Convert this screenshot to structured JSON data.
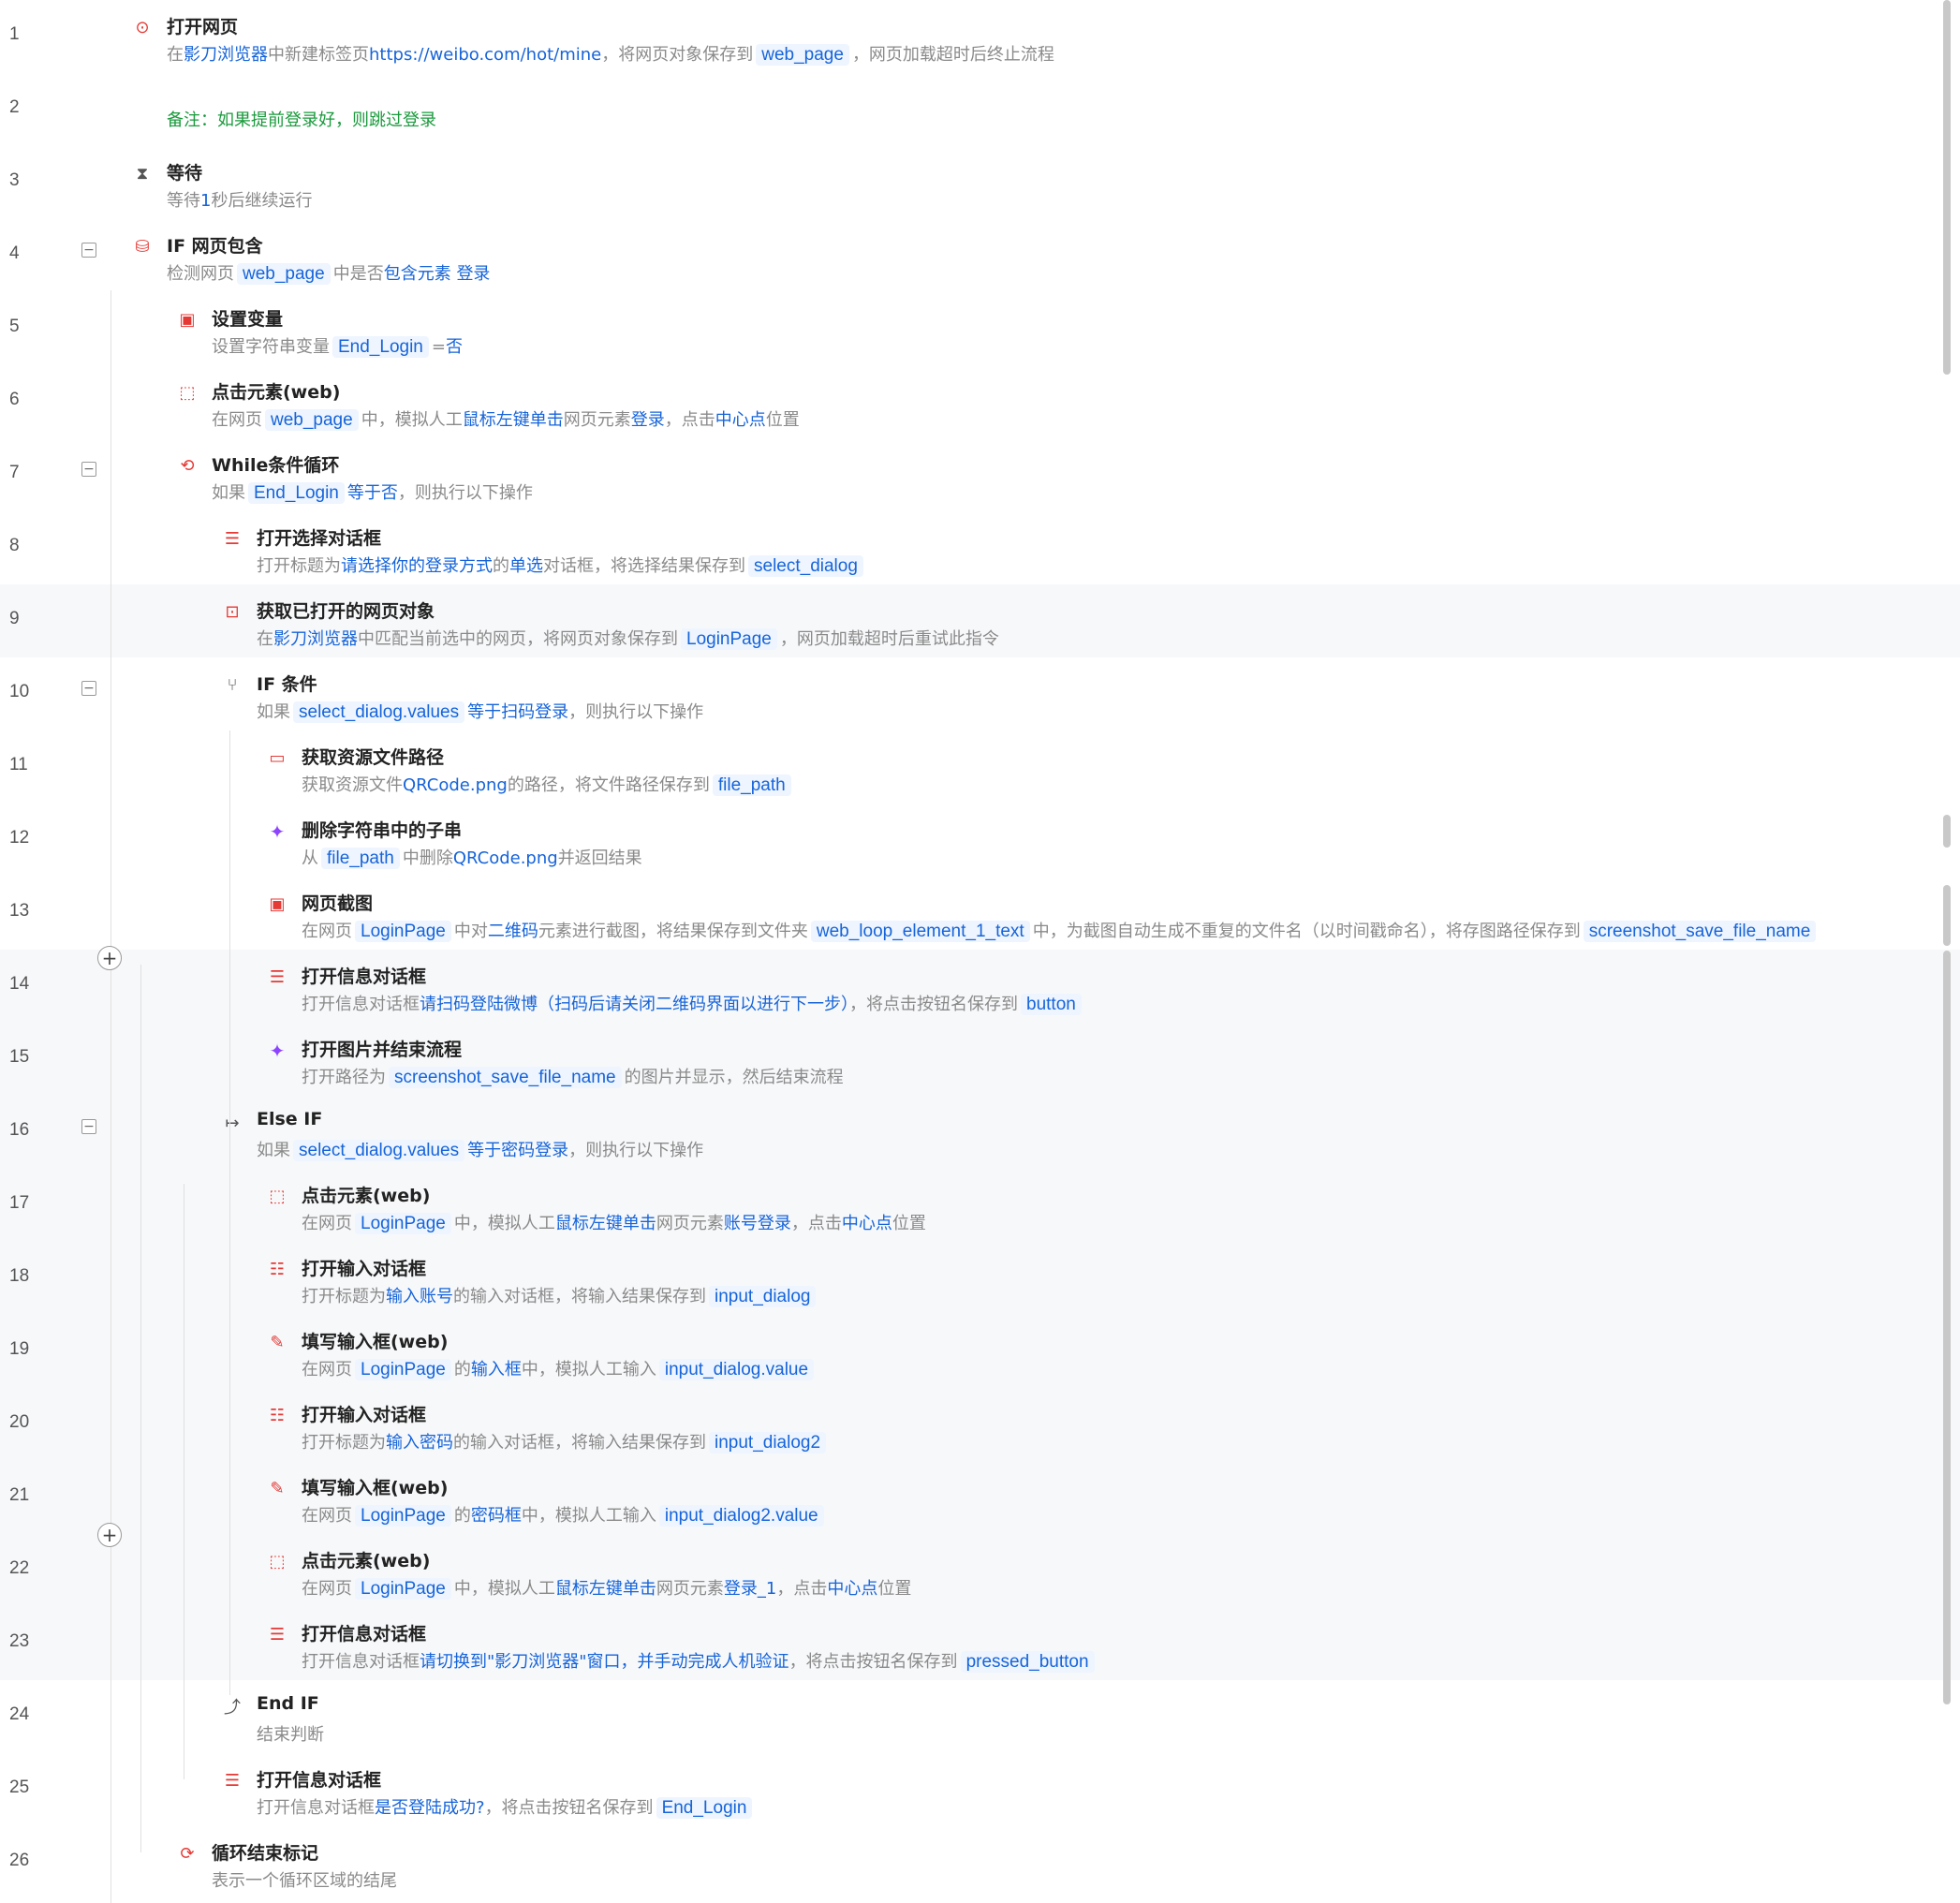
{
  "steps": [
    {
      "n": "1",
      "title": "打开网页",
      "icon": "browser-open-icon",
      "parts": [
        {
          "t": "在"
        },
        {
          "t": "影刀浏览器",
          "k": 1
        },
        {
          "t": "中新建标签页"
        },
        {
          "t": "https://weibo.com/hot/mine",
          "k": 1
        },
        {
          "t": "，将网页对象保存到"
        },
        {
          "t": "web_page",
          "v": 1
        },
        {
          "t": "，网页加载超时后终止流程"
        }
      ]
    },
    {
      "n": "2",
      "title": "",
      "icon": "",
      "note": "备注：如果提前登录好，则跳过登录",
      "parts": []
    },
    {
      "n": "3",
      "title": "等待",
      "icon": "hourglass-icon",
      "parts": [
        {
          "t": "等待"
        },
        {
          "t": "1",
          "k": 1
        },
        {
          "t": "秒后继续运行"
        }
      ]
    },
    {
      "n": "4",
      "title": "IF 网页包含",
      "icon": "web-check-icon",
      "parts": [
        {
          "t": "检测网页"
        },
        {
          "t": "web_page",
          "v": 1
        },
        {
          "t": "中是否"
        },
        {
          "t": "包含元素",
          "k": 1
        },
        {
          "t": " "
        },
        {
          "t": "登录",
          "k": 1
        }
      ]
    },
    {
      "n": "5",
      "title": "设置变量",
      "icon": "variable-icon",
      "parts": [
        {
          "t": "设置字符串变量"
        },
        {
          "t": "End_Login",
          "v": 1
        },
        {
          "t": "="
        },
        {
          "t": "否",
          "k": 1
        }
      ]
    },
    {
      "n": "6",
      "title": "点击元素(web)",
      "icon": "click-element-icon",
      "parts": [
        {
          "t": "在网页"
        },
        {
          "t": "web_page",
          "v": 1
        },
        {
          "t": "中，模拟人工"
        },
        {
          "t": "鼠标左键单击",
          "k": 1
        },
        {
          "t": "网页元素"
        },
        {
          "t": "登录",
          "k": 1
        },
        {
          "t": "，点击"
        },
        {
          "t": "中心点",
          "k": 1
        },
        {
          "t": "位置"
        }
      ]
    },
    {
      "n": "7",
      "title": "While条件循环",
      "icon": "while-loop-icon",
      "parts": [
        {
          "t": "如果"
        },
        {
          "t": "End_Login",
          "v": 1
        },
        {
          "t": "等于否",
          "k": 1
        },
        {
          "t": "，则执行以下操作"
        }
      ]
    },
    {
      "n": "8",
      "title": "打开选择对话框",
      "icon": "select-dialog-icon",
      "parts": [
        {
          "t": "打开标题为"
        },
        {
          "t": "请选择你的登录方式",
          "k": 1
        },
        {
          "t": "的"
        },
        {
          "t": "单选",
          "k": 1
        },
        {
          "t": "对话框，将选择结果保存到"
        },
        {
          "t": "select_dialog",
          "v": 1
        }
      ]
    },
    {
      "n": "9",
      "title": "获取已打开的网页对象",
      "icon": "get-webpage-icon",
      "parts": [
        {
          "t": "在"
        },
        {
          "t": "影刀浏览器",
          "k": 1
        },
        {
          "t": "中匹配当前选中的网页，将网页对象保存到"
        },
        {
          "t": "LoginPage",
          "v": 1
        },
        {
          "t": "，网页加载超时后重试此指令"
        }
      ]
    },
    {
      "n": "10",
      "title": "IF 条件",
      "icon": "if-condition-icon",
      "parts": [
        {
          "t": "如果"
        },
        {
          "t": "select_dialog.values",
          "v": 1
        },
        {
          "t": "等于扫码登录",
          "k": 1
        },
        {
          "t": "，则执行以下操作"
        }
      ]
    },
    {
      "n": "11",
      "title": "获取资源文件路径",
      "icon": "folder-path-icon",
      "parts": [
        {
          "t": "获取资源文件"
        },
        {
          "t": "QRCode.png",
          "k": 1
        },
        {
          "t": "的路径，将文件路径保存到"
        },
        {
          "t": "file_path",
          "v": 1
        }
      ]
    },
    {
      "n": "12",
      "title": "删除字符串中的子串",
      "icon": "ai-sparkle-icon",
      "parts": [
        {
          "t": "从"
        },
        {
          "t": "file_path",
          "v": 1
        },
        {
          "t": "中删除"
        },
        {
          "t": "QRCode.png",
          "k": 1
        },
        {
          "t": "并返回结果"
        }
      ]
    },
    {
      "n": "13",
      "title": "网页截图",
      "icon": "screenshot-icon",
      "parts": [
        {
          "t": "在网页"
        },
        {
          "t": "LoginPage",
          "v": 1
        },
        {
          "t": "中对"
        },
        {
          "t": "二维码",
          "k": 1
        },
        {
          "t": "元素进行截图，将结果保存到文件夹"
        },
        {
          "t": "web_loop_element_1_text",
          "v": 1
        },
        {
          "t": "中，为截图自动生成不重复的文件名（以时间戳命名），将存图路径保存到"
        },
        {
          "t": "screenshot_save_file_name",
          "v": 1
        }
      ]
    },
    {
      "n": "14",
      "title": "打开信息对话框",
      "icon": "message-dialog-icon",
      "parts": [
        {
          "t": "打开信息对话框"
        },
        {
          "t": "请扫码登陆微博（扫码后请关闭二维码界面以进行下一步）",
          "k": 1
        },
        {
          "t": "，将点击按钮名保存到"
        },
        {
          "t": "button",
          "v": 1
        }
      ]
    },
    {
      "n": "15",
      "title": "打开图片并结束流程",
      "icon": "ai-sparkle-icon",
      "parts": [
        {
          "t": "打开路径为"
        },
        {
          "t": "screenshot_save_file_name",
          "v": 1
        },
        {
          "t": "的图片并显示，然后结束流程"
        }
      ]
    },
    {
      "n": "16",
      "title": "Else IF",
      "icon": "else-if-icon",
      "parts": [
        {
          "t": "如果"
        },
        {
          "t": "select_dialog.values",
          "v": 1
        },
        {
          "t": "等于密码登录",
          "k": 1
        },
        {
          "t": "，则执行以下操作"
        }
      ]
    },
    {
      "n": "17",
      "title": "点击元素(web)",
      "icon": "click-element-icon",
      "parts": [
        {
          "t": "在网页"
        },
        {
          "t": "LoginPage",
          "v": 1
        },
        {
          "t": "中，模拟人工"
        },
        {
          "t": "鼠标左键单击",
          "k": 1
        },
        {
          "t": "网页元素"
        },
        {
          "t": "账号登录",
          "k": 1
        },
        {
          "t": "，点击"
        },
        {
          "t": "中心点",
          "k": 1
        },
        {
          "t": "位置"
        }
      ]
    },
    {
      "n": "18",
      "title": "打开输入对话框",
      "icon": "input-dialog-icon",
      "parts": [
        {
          "t": "打开标题为"
        },
        {
          "t": "输入账号",
          "k": 1
        },
        {
          "t": "的输入对话框，将输入结果保存到"
        },
        {
          "t": "input_dialog",
          "v": 1
        }
      ]
    },
    {
      "n": "19",
      "title": "填写输入框(web)",
      "icon": "fill-input-icon",
      "parts": [
        {
          "t": "在网页"
        },
        {
          "t": "LoginPage",
          "v": 1
        },
        {
          "t": "的"
        },
        {
          "t": "输入框",
          "k": 1
        },
        {
          "t": "中，模拟人工输入"
        },
        {
          "t": "input_dialog.value",
          "v": 1
        }
      ]
    },
    {
      "n": "20",
      "title": "打开输入对话框",
      "icon": "input-dialog-icon",
      "parts": [
        {
          "t": "打开标题为"
        },
        {
          "t": "输入密码",
          "k": 1
        },
        {
          "t": "的输入对话框，将输入结果保存到"
        },
        {
          "t": "input_dialog2",
          "v": 1
        }
      ]
    },
    {
      "n": "21",
      "title": "填写输入框(web)",
      "icon": "fill-input-icon",
      "parts": [
        {
          "t": "在网页"
        },
        {
          "t": "LoginPage",
          "v": 1
        },
        {
          "t": "的"
        },
        {
          "t": "密码框",
          "k": 1
        },
        {
          "t": "中，模拟人工输入"
        },
        {
          "t": "input_dialog2.value",
          "v": 1
        }
      ]
    },
    {
      "n": "22",
      "title": "点击元素(web)",
      "icon": "click-element-icon",
      "parts": [
        {
          "t": "在网页"
        },
        {
          "t": "LoginPage",
          "v": 1
        },
        {
          "t": "中，模拟人工"
        },
        {
          "t": "鼠标左键单击",
          "k": 1
        },
        {
          "t": "网页元素"
        },
        {
          "t": "登录_1",
          "k": 1
        },
        {
          "t": "，点击"
        },
        {
          "t": "中心点",
          "k": 1
        },
        {
          "t": "位置"
        }
      ]
    },
    {
      "n": "23",
      "title": "打开信息对话框",
      "icon": "message-dialog-icon",
      "parts": [
        {
          "t": "打开信息对话框"
        },
        {
          "t": "请切换到\"影刀浏览器\"窗口，并手动完成人机验证",
          "k": 1
        },
        {
          "t": "，将点击按钮名保存到"
        },
        {
          "t": "pressed_button",
          "v": 1
        }
      ]
    },
    {
      "n": "24",
      "title": "End IF",
      "icon": "end-if-icon",
      "parts": [
        {
          "t": "结束判断"
        }
      ]
    },
    {
      "n": "25",
      "title": "打开信息对话框",
      "icon": "message-dialog-icon",
      "parts": [
        {
          "t": "打开信息对话框"
        },
        {
          "t": "是否登陆成功?",
          "k": 1
        },
        {
          "t": "，将点击按钮名保存到"
        },
        {
          "t": "End_Login",
          "v": 1
        }
      ]
    },
    {
      "n": "26",
      "title": "循环结束标记",
      "icon": "loop-end-icon",
      "parts": [
        {
          "t": "表示一个循环区域的结尾"
        }
      ]
    }
  ],
  "controls": {
    "collapse_glyph": "−",
    "add_glyph": "+"
  }
}
